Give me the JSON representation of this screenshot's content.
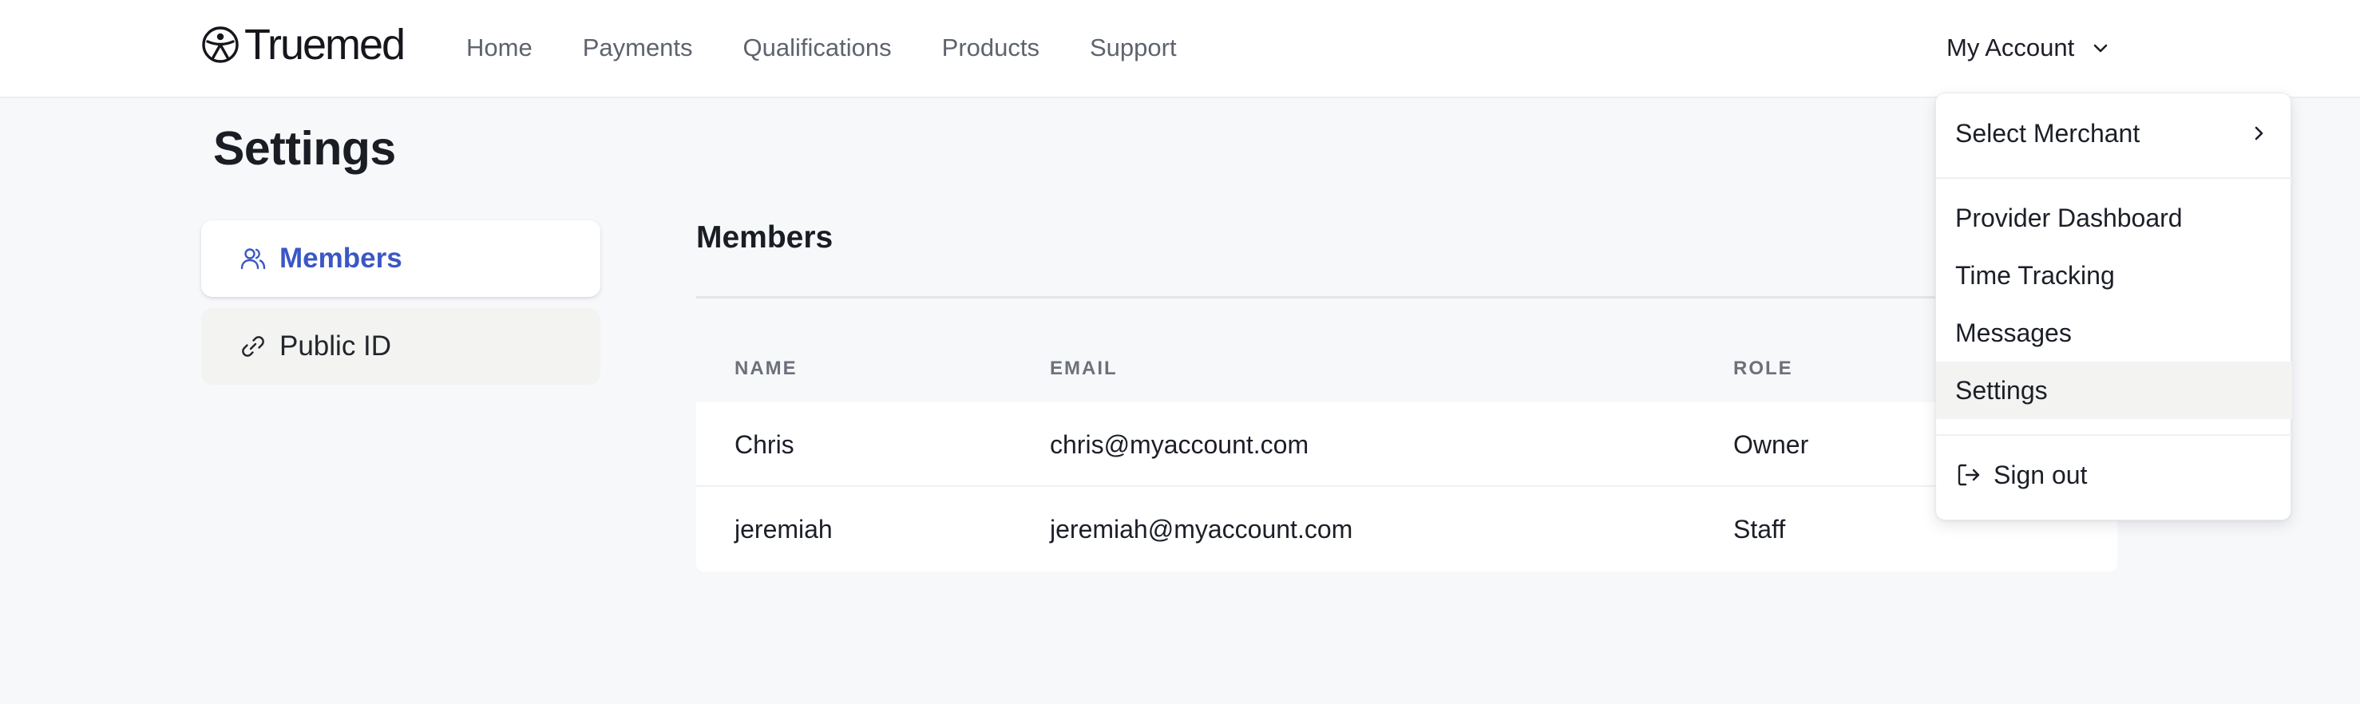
{
  "brand": {
    "name": "Truemed"
  },
  "nav": {
    "items": [
      {
        "label": "Home"
      },
      {
        "label": "Payments"
      },
      {
        "label": "Qualifications"
      },
      {
        "label": "Products"
      },
      {
        "label": "Support"
      }
    ]
  },
  "account": {
    "label": "My Account",
    "icon": "chevron-down-icon"
  },
  "page": {
    "title": "Settings"
  },
  "sidebar": {
    "items": [
      {
        "label": "Members",
        "icon": "users-icon",
        "active": true
      },
      {
        "label": "Public ID",
        "icon": "link-icon",
        "active": false
      }
    ]
  },
  "members": {
    "heading": "Members",
    "columns": [
      "NAME",
      "EMAIL",
      "ROLE"
    ],
    "rows": [
      {
        "name": "Chris",
        "email": "chris@myaccount.com",
        "role": "Owner"
      },
      {
        "name": "jeremiah",
        "email": "jeremiah@myaccount.com",
        "role": "Staff"
      }
    ]
  },
  "dropdown": {
    "select_merchant": "Select Merchant",
    "links": [
      {
        "label": "Provider Dashboard"
      },
      {
        "label": "Time Tracking"
      },
      {
        "label": "Messages"
      },
      {
        "label": "Settings",
        "highlighted": true
      }
    ],
    "sign_out": "Sign out"
  },
  "colors": {
    "accent": "#3b57c4",
    "page_bg": "#f7f8fa",
    "text": "#1c1f27",
    "muted": "#5e636d"
  }
}
